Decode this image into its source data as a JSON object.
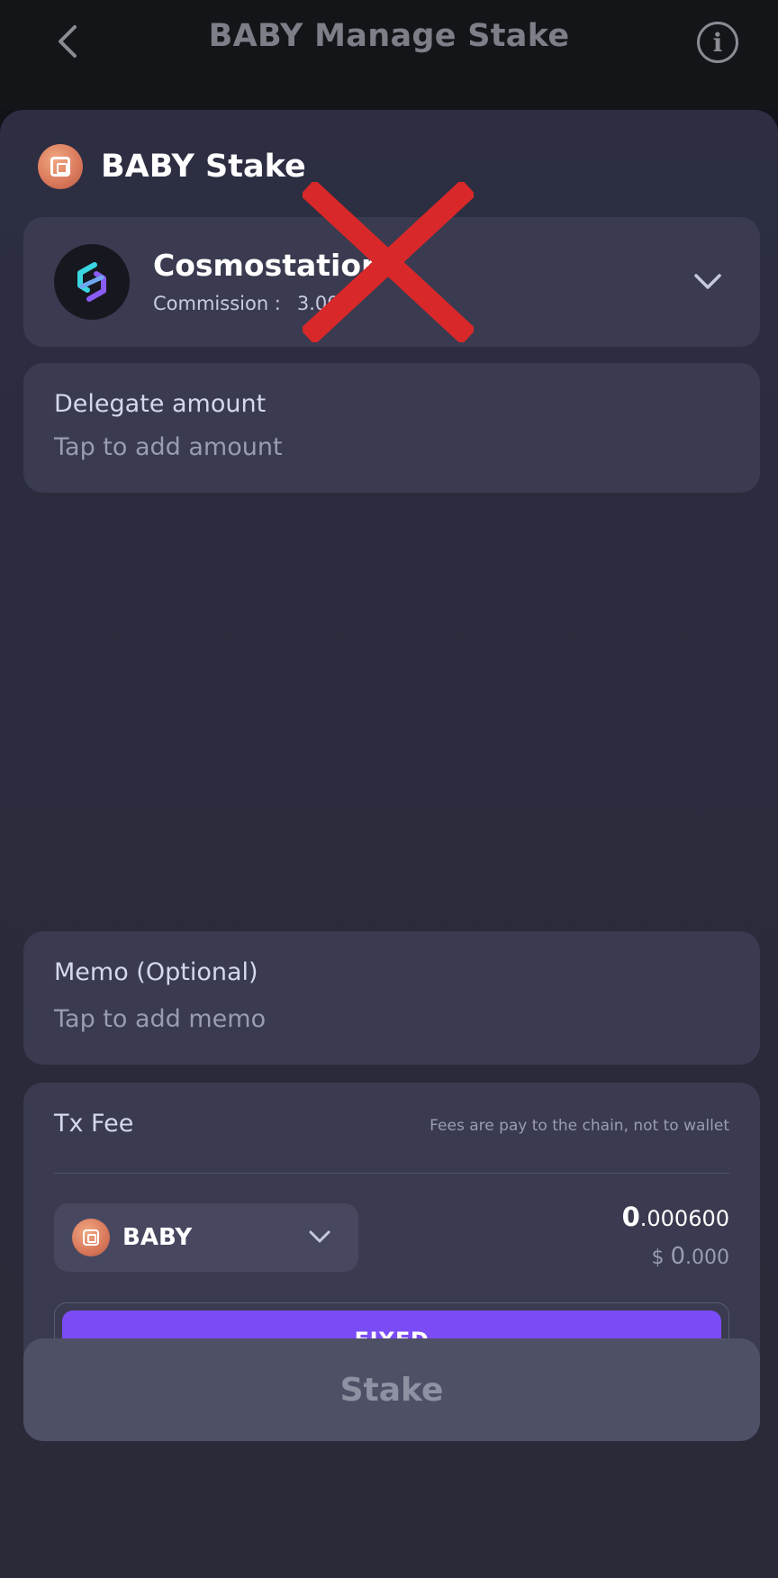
{
  "header": {
    "title": "BABY Manage Stake",
    "info_glyph": "i"
  },
  "sheet": {
    "title": "BABY Stake"
  },
  "validator": {
    "name": "Cosmostation",
    "commission_label": "Commission :",
    "commission_value": "3.00"
  },
  "delegate": {
    "label": "Delegate amount",
    "placeholder": "Tap to add amount"
  },
  "memo": {
    "label": "Memo (Optional)",
    "placeholder": "Tap to add memo"
  },
  "fee": {
    "label": "Tx Fee",
    "note": "Fees are pay to the chain, not to wallet",
    "token": "BABY",
    "amount_int": "0",
    "amount_dec": ".000600",
    "usd_symbol": "$ ",
    "usd_int": "0",
    "usd_dec": ".000",
    "mode_label": "FIXED"
  },
  "actions": {
    "stake_label": "Stake"
  },
  "colors": {
    "accent": "#7b4cf5",
    "background": "#121318",
    "card": "#3a3b50",
    "disabled_button": "#4e5066",
    "validator_logo_cyan": "#3ad6e0",
    "validator_logo_purple": "#8a5cf6",
    "coin": "#d8775a",
    "overlay_x": "#d8282a"
  },
  "icons": {
    "back": "chevron-left-icon",
    "info": "info-circle-icon",
    "dropdown": "chevron-down-icon",
    "coin": "baby-token-icon",
    "validator": "cosmostation-logo-icon",
    "overlay": "red-x-mark"
  }
}
